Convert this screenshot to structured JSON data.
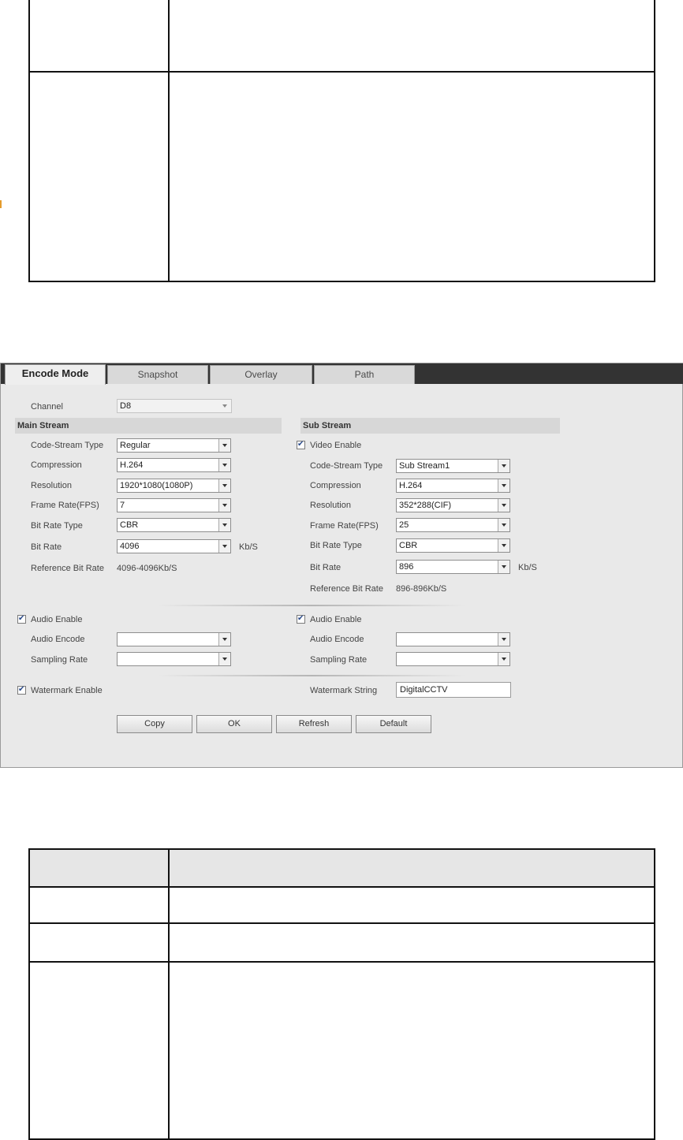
{
  "tabs": [
    {
      "label": "Encode Mode",
      "active": true
    },
    {
      "label": "Snapshot",
      "active": false
    },
    {
      "label": "Overlay",
      "active": false
    },
    {
      "label": "Path",
      "active": false
    }
  ],
  "channel": {
    "label": "Channel",
    "value": "D8"
  },
  "main_stream": {
    "title": "Main Stream",
    "code_stream_type": {
      "label": "Code-Stream Type",
      "value": "Regular"
    },
    "compression": {
      "label": "Compression",
      "value": "H.264"
    },
    "resolution": {
      "label": "Resolution",
      "value": "1920*1080(1080P)"
    },
    "frame_rate": {
      "label": "Frame Rate(FPS)",
      "value": "7"
    },
    "bit_rate_type": {
      "label": "Bit Rate Type",
      "value": "CBR"
    },
    "bit_rate": {
      "label": "Bit Rate",
      "value": "4096",
      "unit": "Kb/S"
    },
    "reference_bit_rate": {
      "label": "Reference Bit Rate",
      "value": "4096-4096Kb/S"
    },
    "audio_enable": {
      "label": "Audio Enable",
      "checked": true
    },
    "audio_encode": {
      "label": "Audio Encode",
      "value": ""
    },
    "sampling_rate": {
      "label": "Sampling Rate",
      "value": ""
    },
    "watermark_enable": {
      "label": "Watermark Enable",
      "checked": true
    }
  },
  "sub_stream": {
    "title": "Sub Stream",
    "video_enable": {
      "label": "Video Enable",
      "checked": true
    },
    "code_stream_type": {
      "label": "Code-Stream Type",
      "value": "Sub Stream1"
    },
    "compression": {
      "label": "Compression",
      "value": "H.264"
    },
    "resolution": {
      "label": "Resolution",
      "value": "352*288(CIF)"
    },
    "frame_rate": {
      "label": "Frame Rate(FPS)",
      "value": "25"
    },
    "bit_rate_type": {
      "label": "Bit Rate Type",
      "value": "CBR"
    },
    "bit_rate": {
      "label": "Bit Rate",
      "value": "896",
      "unit": "Kb/S"
    },
    "reference_bit_rate": {
      "label": "Reference Bit Rate",
      "value": "896-896Kb/S"
    },
    "audio_enable": {
      "label": "Audio Enable",
      "checked": true
    },
    "audio_encode": {
      "label": "Audio Encode",
      "value": ""
    },
    "sampling_rate": {
      "label": "Sampling Rate",
      "value": ""
    },
    "watermark_string": {
      "label": "Watermark String",
      "value": "DigitalCCTV"
    }
  },
  "buttons": {
    "copy": "Copy",
    "ok": "OK",
    "refresh": "Refresh",
    "default": "Default"
  },
  "colors": {
    "tab_strip": "#333333",
    "panel_bg": "#e9e9e9",
    "section_bar": "#d7d7d7",
    "check_mark": "#2a4a8a"
  },
  "icons": {
    "dropdown": "chevron-down-icon",
    "check": "checkmark-icon"
  }
}
